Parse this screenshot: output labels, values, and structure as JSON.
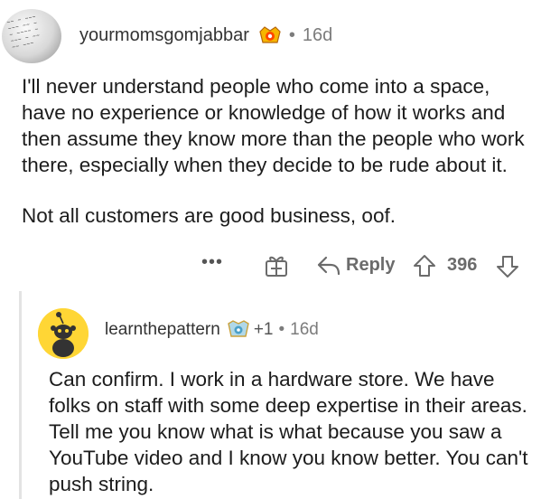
{
  "comment": {
    "username": "yourmomsgomjabbar",
    "separator": "•",
    "age": "16d",
    "paragraphs": [
      "I'll never understand people who come into a space, have no experience or knowledge of how it works and then assume they know more than the people who work there, especially when they decide to be rude about it.",
      "Not all customers are good business, oof."
    ],
    "actions": {
      "more_label": "•••",
      "reply_label": "Reply",
      "score": "396"
    }
  },
  "reply": {
    "username": "learnthepattern",
    "award_count": "+1",
    "separator": "•",
    "age": "16d",
    "paragraphs": [
      "Can confirm. I work in a hardware store. We have folks on staff with some deep expertise in their areas. Tell me you know what is what because you saw a YouTube video and I know you know better.  You can't push string."
    ]
  },
  "colors": {
    "meta_text": "#7c7c7c",
    "action_text": "#6b6b6b",
    "reply_avatar_bg": "#ffd635",
    "thread_line": "#e3e3e3"
  },
  "icons": {
    "badge1": "reddit-premium-badge-icon",
    "award": "gift-icon",
    "reply": "reply-arrow-icon",
    "upvote": "upvote-arrow-icon",
    "downvote": "downvote-arrow-icon",
    "badge2": "award-badge-icon"
  }
}
